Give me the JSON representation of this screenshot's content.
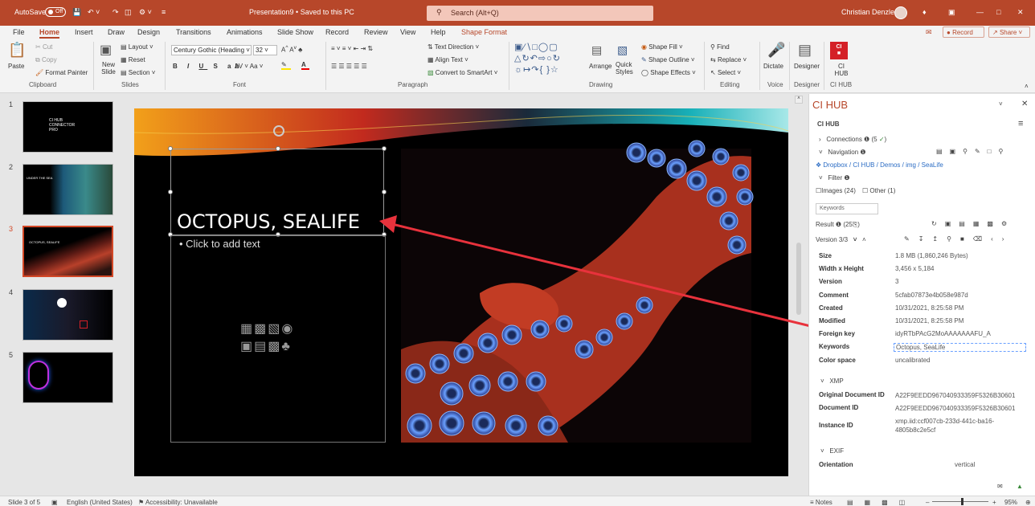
{
  "titlebar": {
    "autosave_label": "AutoSave",
    "autosave_state": "Off",
    "doc_title": "Presentation9 • Saved to this PC",
    "search_placeholder": "Search (Alt+Q)",
    "user_name": "Christian Denzler"
  },
  "tabs": [
    "File",
    "Home",
    "Insert",
    "Draw",
    "Design",
    "Transitions",
    "Animations",
    "Slide Show",
    "Record",
    "Review",
    "View",
    "Help",
    "Shape Format"
  ],
  "active_tab": "Home",
  "record_button": "Record",
  "share_button": "Share",
  "ribbon": {
    "clipboard": {
      "paste": "Paste",
      "cut": "Cut",
      "copy": "Copy",
      "format_painter": "Format Painter",
      "group": "Clipboard"
    },
    "slides": {
      "new_slide": "New Slide",
      "layout": "Layout",
      "reset": "Reset",
      "section": "Section",
      "group": "Slides"
    },
    "font": {
      "family": "Century Gothic (Heading",
      "size": "32",
      "group": "Font"
    },
    "paragraph": {
      "text_direction": "Text Direction",
      "align_text": "Align Text",
      "convert_smartart": "Convert to SmartArt",
      "group": "Paragraph"
    },
    "drawing": {
      "arrange": "Arrange",
      "quick_styles": "Quick Styles",
      "shape_fill": "Shape Fill",
      "shape_outline": "Shape Outline",
      "shape_effects": "Shape Effects",
      "group": "Drawing"
    },
    "editing": {
      "find": "Find",
      "replace": "Replace",
      "select": "Select",
      "group": "Editing"
    },
    "voice": {
      "dictate": "Dictate",
      "group": "Voice"
    },
    "designer": {
      "designer": "Designer",
      "group": "Designer"
    },
    "cihub": {
      "label": "CI HUB",
      "group": "CI HUB"
    }
  },
  "thumbnails": [
    {
      "num": "1",
      "caption": "CI HUB CONNECTOR PRO"
    },
    {
      "num": "2",
      "caption": "UNDER THE SEA"
    },
    {
      "num": "3",
      "caption": "OCTOPUS, SEALIFE"
    },
    {
      "num": "4",
      "caption": ""
    },
    {
      "num": "5",
      "caption": ""
    }
  ],
  "slide": {
    "title": "OCTOPUS, SEALIFE",
    "placeholder": "Click to add text"
  },
  "panel": {
    "title": "CI HUB",
    "subtitle": "CI HUB",
    "connections": "Connections",
    "connections_count": "(5",
    "navigation": "Navigation",
    "path": "Dropbox / CI HUB / Demos / img / SeaLife",
    "filter": "Filter",
    "images_option": "Images (24)",
    "other_option": "Other (1)",
    "keywords_field": "Keywords",
    "result": "Result",
    "result_count": "(25",
    "version": "Version 3/3",
    "details": [
      {
        "label": "Size",
        "value": "1.8 MB (1,860,246 Bytes)"
      },
      {
        "label": "Width x Height",
        "value": "3,456 x 5,184"
      },
      {
        "label": "Version",
        "value": "3"
      },
      {
        "label": "Comment",
        "value": "5cfab07873e4b058e987d"
      },
      {
        "label": "Created",
        "value": "10/31/2021, 8:25:58 PM"
      },
      {
        "label": "Modified",
        "value": "10/31/2021, 8:25:58 PM"
      },
      {
        "label": "Foreign key",
        "value": "idyRTbPAcG2MoAAAAAAAFU_A"
      },
      {
        "label": "Keywords",
        "value": "Octopus, SeaLife"
      },
      {
        "label": "Color space",
        "value": "uncalibrated"
      }
    ],
    "xmp": "XMP",
    "xmp_details": [
      {
        "label": "Original Document ID",
        "value": "A22F9EEDD967040933359F5326B30601"
      },
      {
        "label": "Document ID",
        "value": "A22F9EEDD967040933359F5326B30601"
      },
      {
        "label": "Instance ID",
        "value": "xmp.iid:ccf007cb-233d-441c-ba16-4805b8c2e5cf"
      }
    ],
    "exif": "EXIF",
    "orientation_label": "Orientation",
    "orientation_value": "vertical"
  },
  "status": {
    "slide_count": "Slide 3 of 5",
    "language": "English (United States)",
    "accessibility": "Accessibility: Unavailable",
    "notes": "Notes",
    "zoom": "95%"
  },
  "colors": {
    "accent": "#b7472a",
    "selection": "#d24726",
    "arrow": "#e8323c",
    "link": "#2b6cc4"
  }
}
